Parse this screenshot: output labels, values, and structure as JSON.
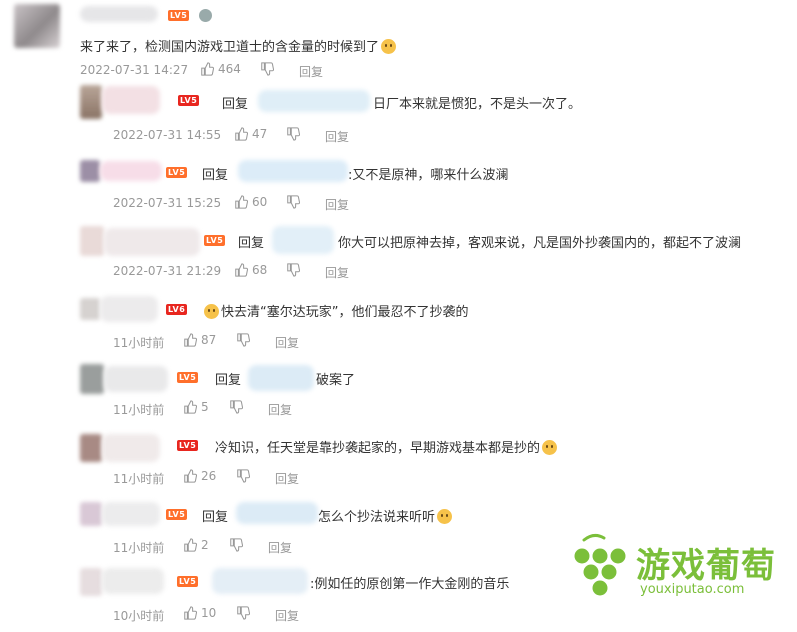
{
  "comments": [
    {
      "text": "来了来了，检测国内游戏卫道士的含金量的时候到了",
      "level": "LV5",
      "time": "2022-07-31 14:27",
      "likes": "464",
      "reply_label": "回复"
    },
    {
      "reply_prefix": "回复",
      "text": "日厂本来就是惯犯，不是头一次了。",
      "level": "LV5",
      "time": "2022-07-31 14:55",
      "likes": "47",
      "reply_label": "回复"
    },
    {
      "reply_prefix": "回复",
      "text": ":又不是原神，哪来什么波澜",
      "level": "LV5",
      "time": "2022-07-31 15:25",
      "likes": "60",
      "reply_label": "回复"
    },
    {
      "reply_prefix": "回复",
      "text": "你大可以把原神去掉，客观来说，凡是国外抄袭国内的，都起不了波澜",
      "level": "LV5",
      "time": "2022-07-31 21:29",
      "likes": "68",
      "reply_label": "回复"
    },
    {
      "text": "快去清“塞尔达玩家”，他们最忍不了抄袭的",
      "level": "LV6",
      "time": "11小时前",
      "likes": "87",
      "reply_label": "回复"
    },
    {
      "reply_prefix": "回复",
      "text": "破案了",
      "level": "LV5",
      "time": "11小时前",
      "likes": "5",
      "reply_label": "回复"
    },
    {
      "text": "冷知识，任天堂是靠抄袭起家的，早期游戏基本都是抄的",
      "level": "LV5",
      "time": "11小时前",
      "likes": "26",
      "reply_label": "回复"
    },
    {
      "reply_prefix": "回复",
      "text": "怎么个抄法说来听听",
      "level": "LV5",
      "time": "11小时前",
      "likes": "2",
      "reply_label": "回复"
    },
    {
      "text": ":例如任的原创第一作大金刚的音乐",
      "level": "LV5",
      "time": "10小时前",
      "likes": "10",
      "reply_label": "回复"
    }
  ],
  "watermark": {
    "name": "游戏葡萄",
    "url": "youxiputao.com",
    "color": "#7bbf3a"
  }
}
